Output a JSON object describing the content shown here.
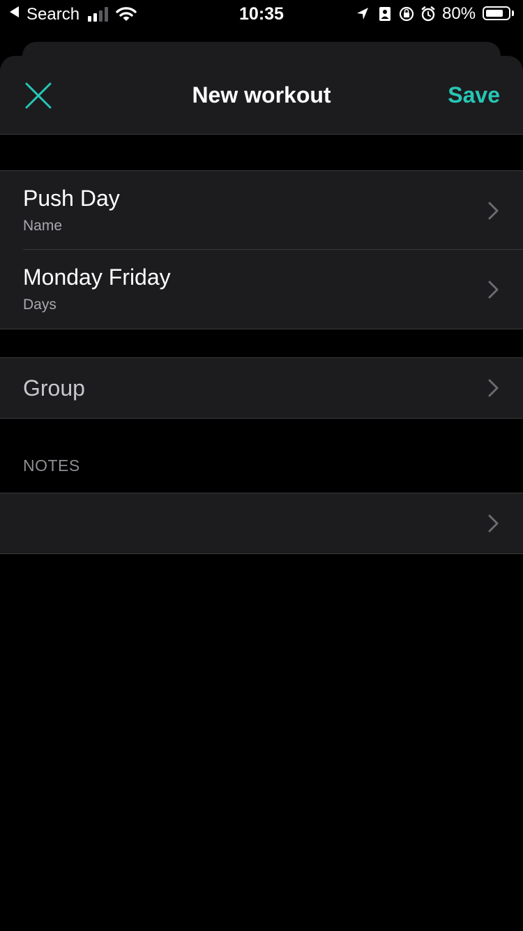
{
  "status_bar": {
    "back_label": "Search",
    "time": "10:35",
    "battery_percent": "80%",
    "battery_level": 0.8,
    "signal_bars": 2,
    "icons": [
      "location-arrow-icon",
      "portrait-id-icon",
      "orientation-lock-icon",
      "alarm-clock-icon"
    ]
  },
  "nav": {
    "title": "New workout",
    "save_label": "Save",
    "close_icon": "close-icon"
  },
  "form": {
    "details": [
      {
        "value": "Push Day",
        "label": "Name"
      },
      {
        "value": "Monday Friday",
        "label": "Days"
      }
    ],
    "group": {
      "placeholder": "Group"
    },
    "notes": {
      "header": "NOTES",
      "value": ""
    }
  },
  "colors": {
    "accent": "#27c6b5",
    "background": "#000000",
    "cell": "#1c1c1e",
    "separator": "#3a3a3c",
    "secondary_text": "#a8a8ad"
  }
}
